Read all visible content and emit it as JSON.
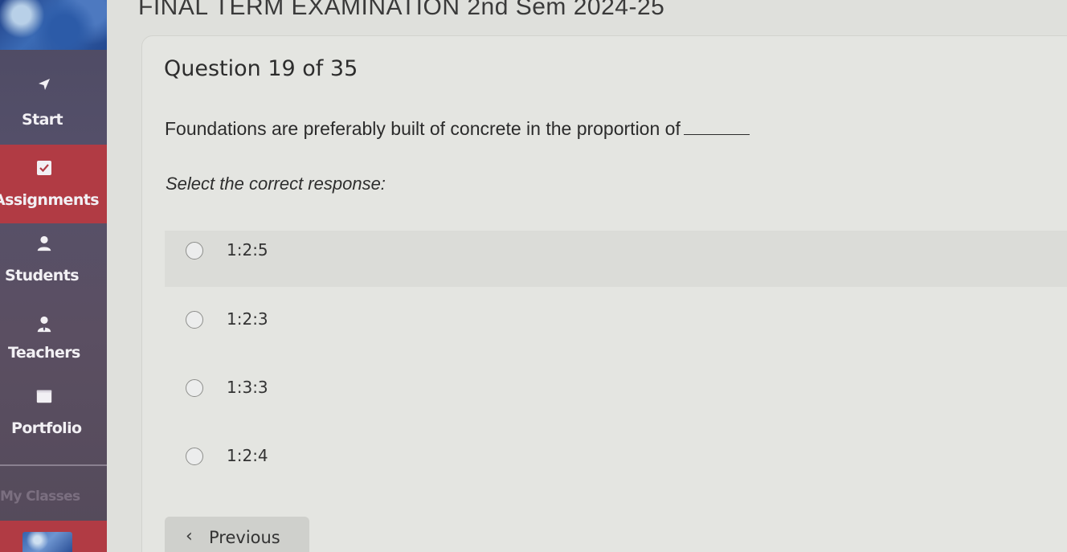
{
  "exam": {
    "title": "FINAL TERM EXAMINATION 2nd Sem 2024-25"
  },
  "sidebar": {
    "items": [
      {
        "label": "Start",
        "icon": "start-arrow-icon"
      },
      {
        "label": "Assignments",
        "icon": "checkbox-icon",
        "active": true
      },
      {
        "label": "Students",
        "icon": "person-icon"
      },
      {
        "label": "Teachers",
        "icon": "teacher-icon"
      },
      {
        "label": "Portfolio",
        "icon": "folder-icon"
      }
    ],
    "section_label": "My Classes",
    "active_color": "#b13b44"
  },
  "question": {
    "number_text": "Question 19 of 35",
    "text": "Foundations are preferably built of concrete in the proportion of",
    "instruction": "Select the correct response:",
    "options": [
      {
        "label": "1:2:5"
      },
      {
        "label": "1:2:3"
      },
      {
        "label": "1:3:3"
      },
      {
        "label": "1:2:4"
      }
    ]
  },
  "navigation": {
    "previous_label": "Previous"
  }
}
